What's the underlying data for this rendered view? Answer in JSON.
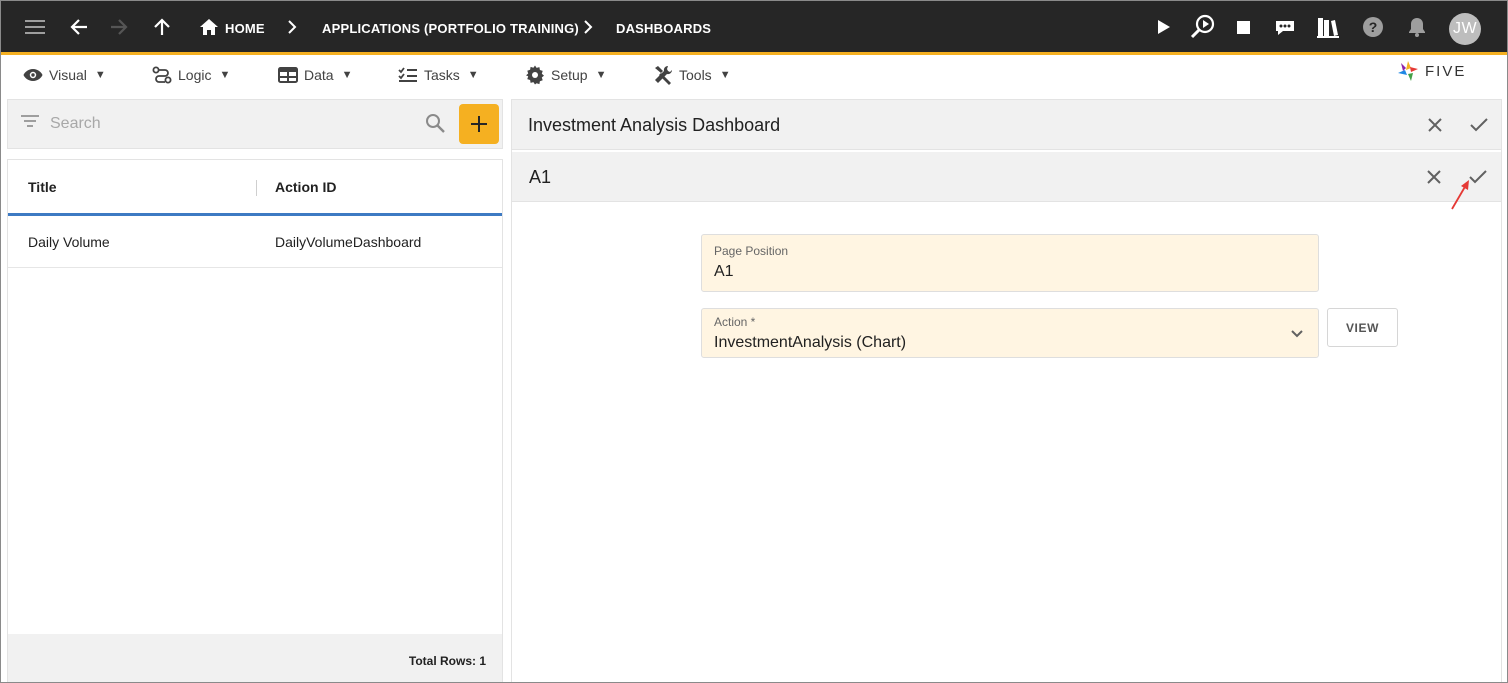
{
  "topbar": {
    "breadcrumbs": {
      "home": "HOME",
      "application": "APPLICATIONS (PORTFOLIO TRAINING)",
      "dashboards": "DASHBOARDS"
    },
    "avatar_initials": "JW",
    "background": "#262626",
    "accent": "#f5b021",
    "icons": [
      "menu-icon",
      "back-arrow-icon",
      "forward-arrow-icon",
      "up-arrow-icon",
      "home-icon",
      "play-icon",
      "inspect-run-icon",
      "stop-icon",
      "chat-icon",
      "library-icon",
      "help-icon",
      "notification-bell-icon"
    ]
  },
  "menubar": {
    "items": [
      {
        "label": "Visual",
        "icon": "eye-icon"
      },
      {
        "label": "Logic",
        "icon": "logic-flow-icon"
      },
      {
        "label": "Data",
        "icon": "table-icon"
      },
      {
        "label": "Tasks",
        "icon": "checklist-icon"
      },
      {
        "label": "Setup",
        "icon": "gear-icon"
      },
      {
        "label": "Tools",
        "icon": "tools-icon"
      }
    ],
    "caret": "▼",
    "logo_text": "FIVE"
  },
  "left": {
    "search_placeholder": "Search",
    "columns": [
      "Title",
      "Action ID"
    ],
    "rows": [
      {
        "title": "Daily Volume",
        "action_id": "DailyVolumeDashboard"
      }
    ],
    "footer": "Total Rows: 1"
  },
  "right": {
    "form_title": "Investment Analysis Dashboard",
    "sub_title": "A1",
    "fields": {
      "page_position": {
        "label": "Page Position",
        "value": "A1"
      },
      "action": {
        "label": "Action *",
        "value": "InvestmentAnalysis (Chart)"
      }
    },
    "view_button": "VIEW",
    "field_background": "#fff5e2"
  }
}
